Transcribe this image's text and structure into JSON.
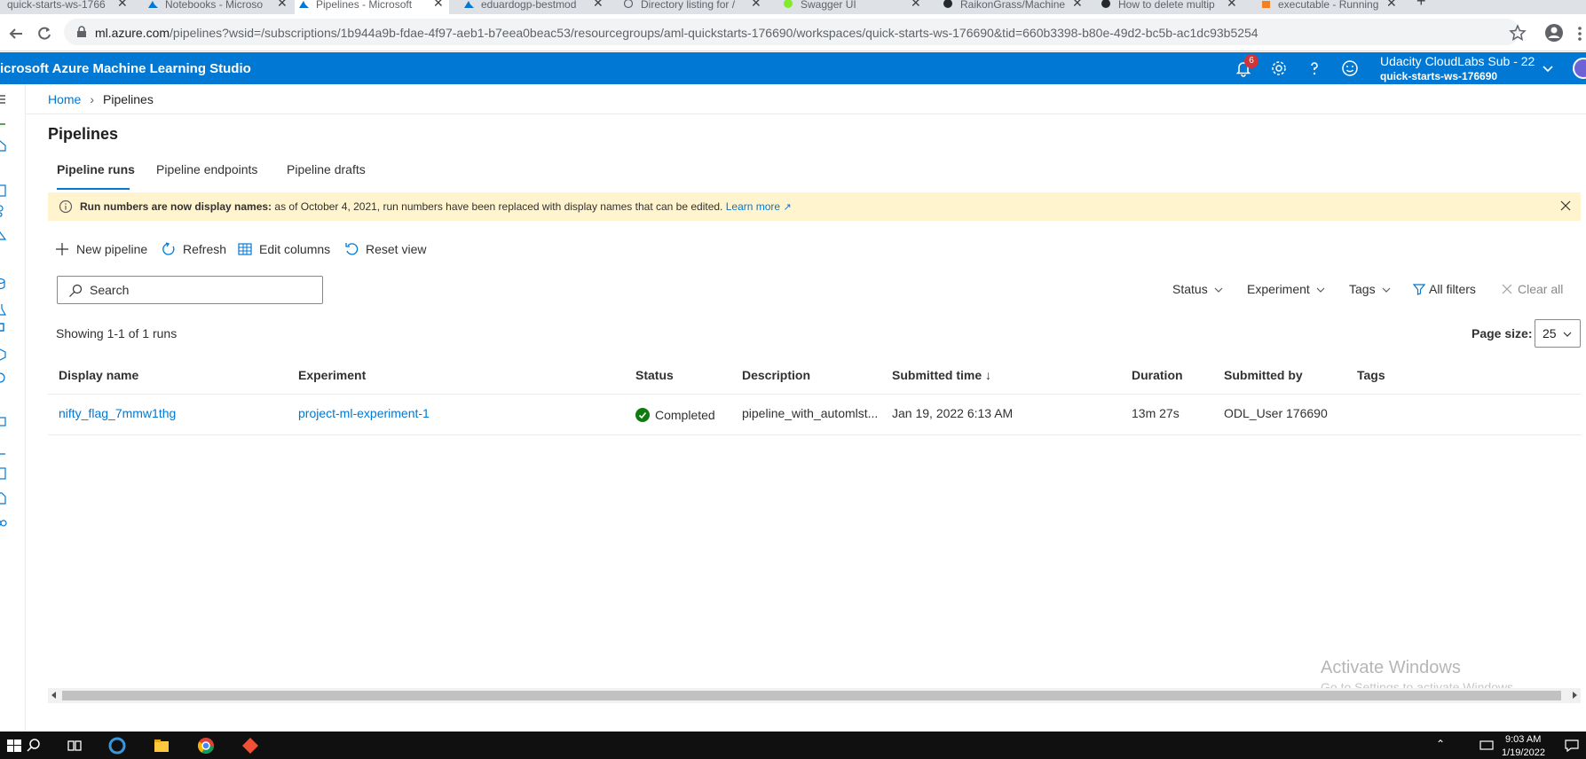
{
  "browser": {
    "tabs": [
      {
        "title": "quick-starts-ws-1766"
      },
      {
        "title": "Notebooks - Microso"
      },
      {
        "title": "Pipelines - Microsoft"
      },
      {
        "title": "eduardogp-bestmod"
      },
      {
        "title": "Directory listing for /"
      },
      {
        "title": "Swagger UI"
      },
      {
        "title": "RaikonGrass/Machine"
      },
      {
        "title": "How to delete multip"
      },
      {
        "title": "executable - Running"
      }
    ],
    "url_host": "ml.azure.com",
    "url_rest": "/pipelines?wsid=/subscriptions/1b944a9b-fdae-4f97-aeb1-b7eea0beac53/resourcegroups/aml-quickstarts-176690/workspaces/quick-starts-ws-176690&tid=660b3398-b80e-49d2-bc5b-ac1dc93b5254"
  },
  "header": {
    "app_title": "icrosoft Azure Machine Learning Studio",
    "notification_count": "6",
    "subscription": "Udacity CloudLabs Sub - 22",
    "workspace": "quick-starts-ws-176690"
  },
  "breadcrumb": {
    "home": "Home",
    "current": "Pipelines"
  },
  "page": {
    "title": "Pipelines",
    "tabs": [
      "Pipeline runs",
      "Pipeline endpoints",
      "Pipeline drafts"
    ],
    "info": {
      "bold": "Run numbers are now display names:",
      "text": " as of October 4, 2021, run numbers have been replaced with display names that can be edited.",
      "link": "Learn more"
    },
    "toolbar": {
      "new_pipeline": "New pipeline",
      "refresh": "Refresh",
      "edit_columns": "Edit columns",
      "reset_view": "Reset view"
    },
    "search_placeholder": "Search",
    "filters": {
      "status": "Status",
      "experiment": "Experiment",
      "tags": "Tags",
      "all_filters": "All filters",
      "clear_all": "Clear all"
    },
    "showing": "Showing 1-1 of 1 runs",
    "page_size_label": "Page size:",
    "page_size": "25",
    "columns": [
      "Display name",
      "Experiment",
      "Status",
      "Description",
      "Submitted time ↓",
      "Duration",
      "Submitted by",
      "Tags"
    ],
    "rows": [
      {
        "display_name": "nifty_flag_7mmw1thg",
        "experiment": "project-ml-experiment-1",
        "status": "Completed",
        "description": "pipeline_with_automlst...",
        "submitted_time": "Jan 19, 2022 6:13 AM",
        "duration": "13m 27s",
        "submitted_by": "ODL_User 176690",
        "tags": ""
      }
    ]
  },
  "watermark": {
    "line1": "Activate Windows",
    "line2": "Go to Settings to activate Windows."
  },
  "taskbar": {
    "time": "9:03 AM",
    "date": "1/19/2022"
  },
  "colors": {
    "accent": "#0078d4",
    "success": "#107c10",
    "info_bg": "#fff4ce"
  }
}
